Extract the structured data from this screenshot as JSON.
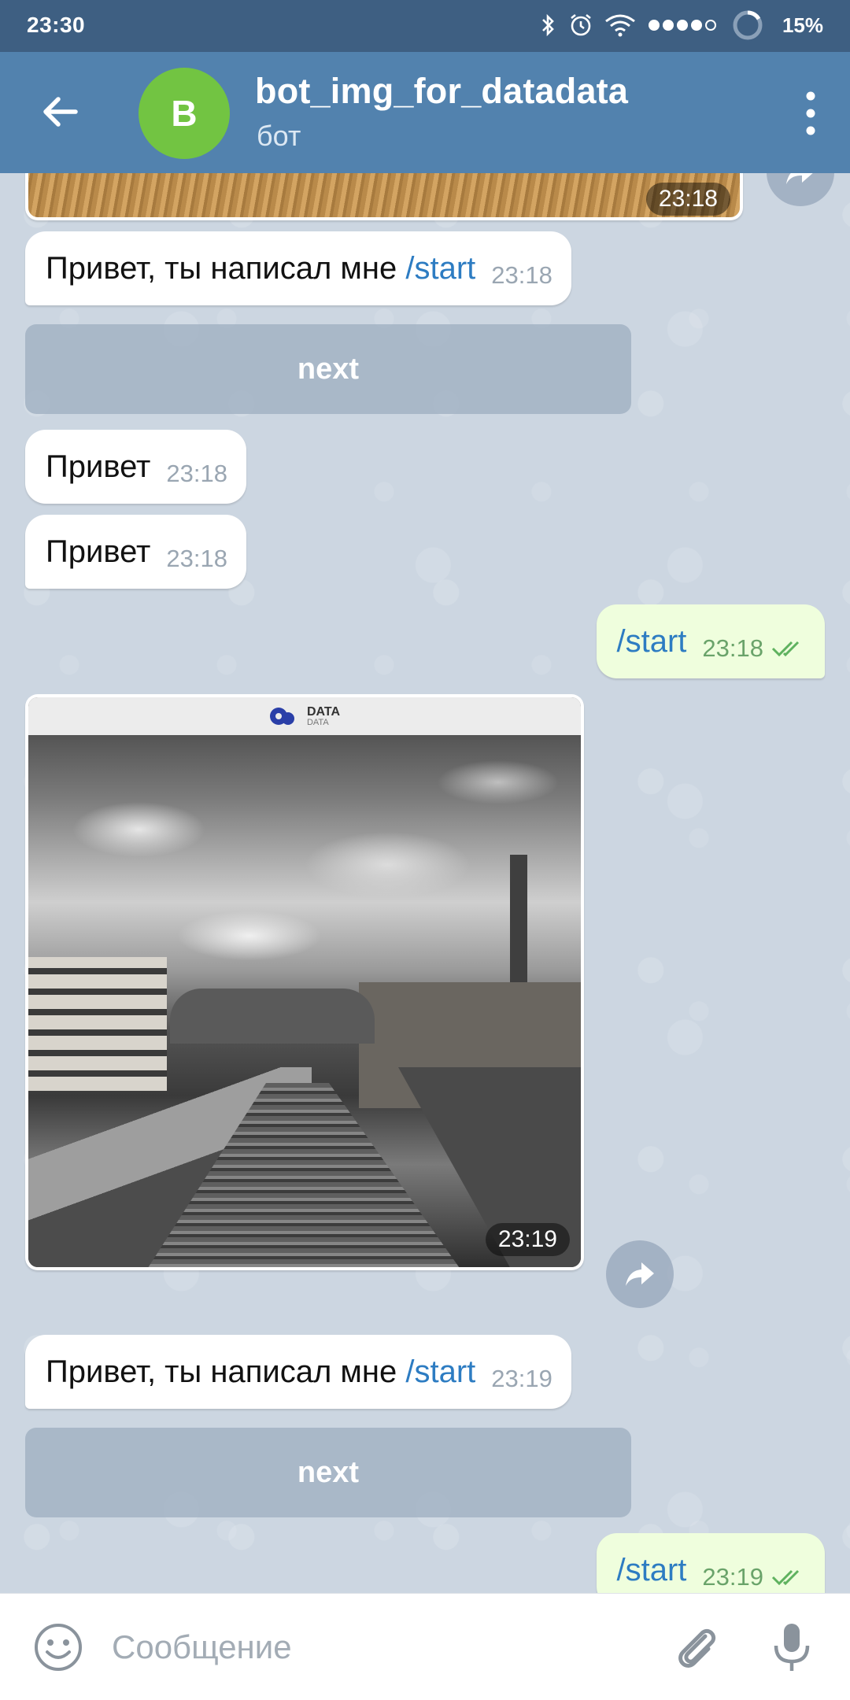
{
  "status_bar": {
    "time": "23:30",
    "battery": "15%",
    "icons": [
      "bluetooth-icon",
      "alarm-icon",
      "wifi-icon",
      "signal-icon",
      "battery-icon"
    ]
  },
  "header": {
    "avatar_letter": "B",
    "title": "bot_img_for_datadata",
    "subtitle": "бот",
    "avatar_color": "#72c442",
    "bar_color": "#5282ae"
  },
  "messages": {
    "top_image_time": "23:18",
    "m1": {
      "text": "Привет, ты написал мне ",
      "command": "/start",
      "time": "23:18"
    },
    "kb1": "next",
    "m2": {
      "text": "Привет",
      "time": "23:18"
    },
    "m3": {
      "text": "Привет",
      "time": "23:18"
    },
    "m4": {
      "command": "/start",
      "time": "23:18"
    },
    "image": {
      "logo_text": "DATA",
      "logo_subtext": "DATA",
      "time": "23:19"
    },
    "m5": {
      "text": "Привет, ты написал мне ",
      "command": "/start",
      "time": "23:19"
    },
    "kb2": "next",
    "m6": {
      "command": "/start",
      "time": "23:19"
    }
  },
  "input": {
    "placeholder": "Сообщение"
  }
}
